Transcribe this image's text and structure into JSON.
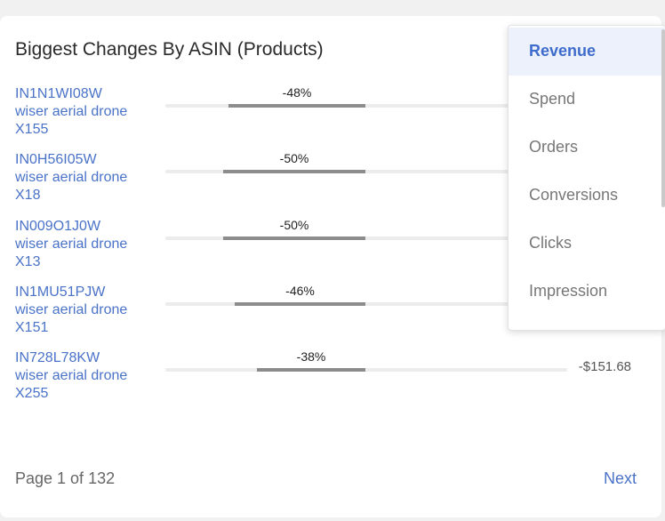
{
  "title": "Biggest Changes By ASIN (Products)",
  "rows": [
    {
      "asin": "IN1N1WI08W",
      "name": "wiser aerial drone",
      "model": "X155",
      "pct": "-48%",
      "change": 0.48,
      "value": ""
    },
    {
      "asin": "IN0H56I05W",
      "name": "wiser aerial drone",
      "model": "X18",
      "pct": "-50%",
      "change": 0.5,
      "value": ""
    },
    {
      "asin": "IN009O1J0W",
      "name": "wiser aerial drone",
      "model": "X13",
      "pct": "-50%",
      "change": 0.5,
      "value": ""
    },
    {
      "asin": "IN1MU51PJW",
      "name": "wiser aerial drone",
      "model": "X151",
      "pct": "-46%",
      "change": 0.46,
      "value": ""
    },
    {
      "asin": "IN728L78KW",
      "name": "wiser aerial drone",
      "model": "X255",
      "pct": "-38%",
      "change": 0.38,
      "value": "-$151.68"
    }
  ],
  "footer": {
    "page": "Page 1 of 132",
    "next": "Next"
  },
  "dropdown": {
    "selected": "Revenue",
    "options": [
      "Revenue",
      "Spend",
      "Orders",
      "Conversions",
      "Clicks",
      "Impression"
    ]
  },
  "colors": {
    "accent": "#4a73c8",
    "bar": "#8c8c8c",
    "track": "#ececec",
    "selected_bg": "#edf1fb"
  }
}
